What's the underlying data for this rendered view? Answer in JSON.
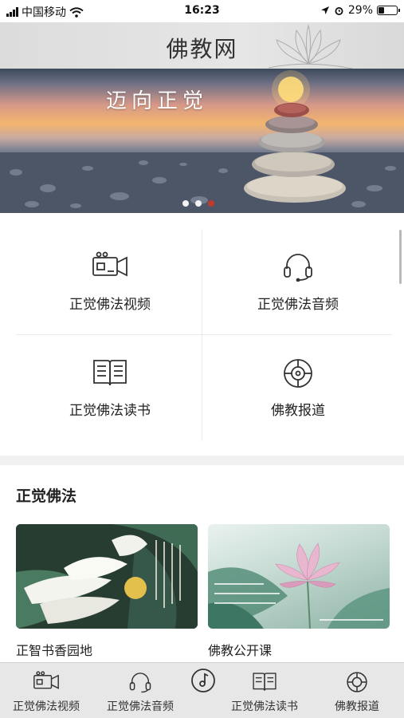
{
  "status_bar": {
    "carrier": "中国移动",
    "time": "16:23",
    "battery": "29%"
  },
  "header": {
    "title": "佛教网"
  },
  "banner": {
    "slogan": "迈向正觉",
    "pages": 3,
    "active_page": 3
  },
  "grid": [
    {
      "label": "正觉佛法视频",
      "icon": "video-camera-icon"
    },
    {
      "label": "正觉佛法音频",
      "icon": "headphones-icon"
    },
    {
      "label": "正觉佛法读书",
      "icon": "book-icon"
    },
    {
      "label": "佛教报道",
      "icon": "dharma-wheel-icon"
    }
  ],
  "section": {
    "title": "正觉佛法"
  },
  "cards": [
    {
      "caption": "正智书香园地",
      "image": "white-lotus-with-calligraphy"
    },
    {
      "caption": "佛教公开课",
      "image": "pink-lotus-with-calligraphy"
    }
  ],
  "tabbar": [
    {
      "label": "正觉佛法视频",
      "icon": "video-camera-icon"
    },
    {
      "label": "正觉佛法音频",
      "icon": "headphones-icon"
    },
    {
      "label": "",
      "icon": "music-disc-icon"
    },
    {
      "label": "正觉佛法读书",
      "icon": "book-icon"
    },
    {
      "label": "佛教报道",
      "icon": "dharma-wheel-icon"
    }
  ],
  "colors": {
    "accent_dot": "#c0392b",
    "header_bg": "#e2e2e2",
    "tabbar_bg": "#e7e7e7"
  }
}
